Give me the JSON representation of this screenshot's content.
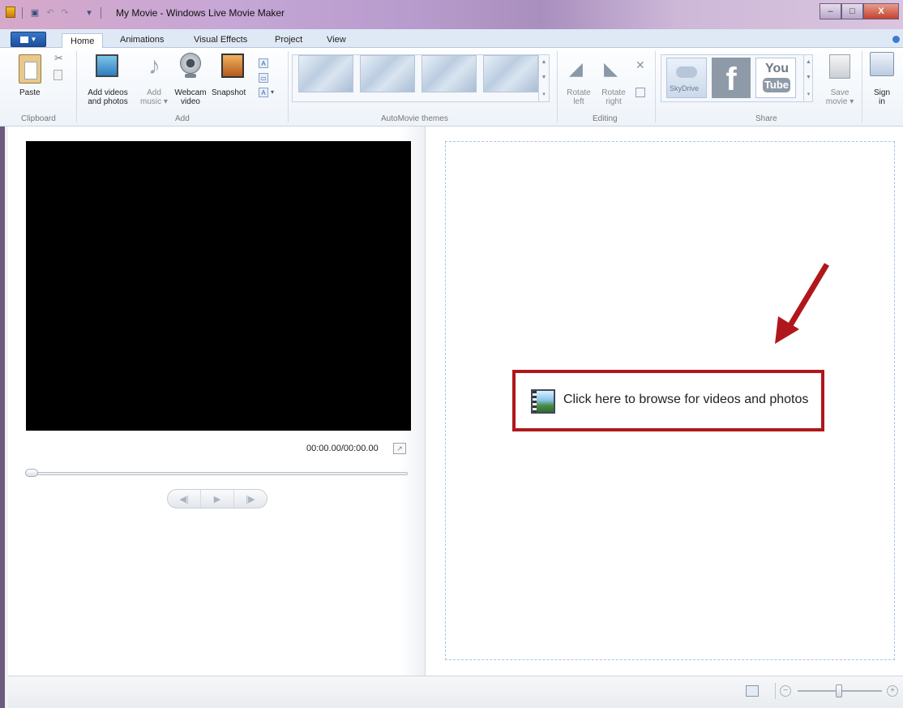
{
  "window": {
    "title": "My Movie - Windows Live Movie Maker",
    "minimize_label": "–",
    "maximize_label": "□",
    "close_label": "X"
  },
  "quick_access": {
    "dropdown_glyph": "▾"
  },
  "ribbon_tabs": [
    {
      "label": "Home"
    },
    {
      "label": "Animations"
    },
    {
      "label": "Visual Effects"
    },
    {
      "label": "Project"
    },
    {
      "label": "View"
    }
  ],
  "ribbon": {
    "paste": "Paste",
    "add_videos": [
      "Add videos",
      "and photos"
    ],
    "add_music": [
      "Add",
      "music ▾"
    ],
    "webcam": [
      "Webcam",
      "video"
    ],
    "snapshot": "Snapshot",
    "rotate_left": [
      "Rotate",
      "left"
    ],
    "rotate_right": [
      "Rotate",
      "right"
    ],
    "skydrive": "SkyDrive",
    "facebook": "f",
    "youtube_you": "You",
    "youtube_tube": "Tube",
    "save_movie": [
      "Save",
      "movie ▾"
    ],
    "sign_in": [
      "Sign",
      "in"
    ]
  },
  "groups": {
    "clipboard": "Clipboard",
    "add": "Add",
    "themes": "AutoMovie themes",
    "editing": "Editing",
    "share": "Share"
  },
  "preview": {
    "timecode": "00:00.00/00:00.00",
    "prev_frame": "◀|",
    "play": "▶",
    "next_frame": "|▶"
  },
  "storyboard": {
    "browse_text": "Click here to browse for videos and photos"
  },
  "statusbar": {
    "zoom_out": "−",
    "zoom_in": "+"
  },
  "colors": {
    "highlight_box": "#b0171c",
    "arrow": "#b0171c",
    "file_button": "#1c4f9e"
  }
}
